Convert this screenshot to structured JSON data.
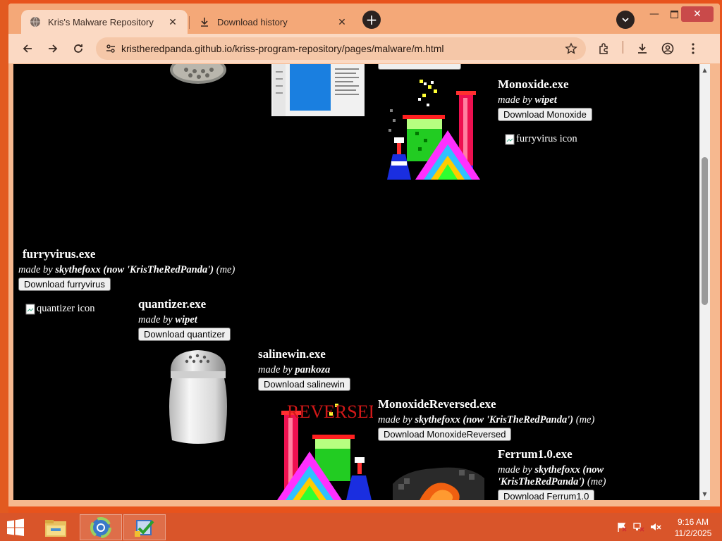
{
  "browser": {
    "tabs": [
      {
        "title": "Kris's Malware Repository",
        "active": true
      },
      {
        "title": "Download history",
        "active": false
      }
    ],
    "url": "kristheredpanda.github.io/kriss-program-repository/pages/malware/m.html"
  },
  "page": {
    "entries": {
      "monoxide": {
        "name": "Monoxide.exe",
        "made_by": "made by",
        "author": "wipet",
        "author_note": "",
        "button": "Download Monoxide"
      },
      "furryvirus": {
        "name": "furryvirus.exe",
        "made_by": "made by",
        "author": "skythefoxx (now 'KrisTheRedPanda')",
        "author_note": "(me)",
        "button": "Download furryvirus"
      },
      "quantizer": {
        "name": "quantizer.exe",
        "made_by": "made by",
        "author": "wipet",
        "author_note": "",
        "button": "Download quantizer"
      },
      "salinewin": {
        "name": "salinewin.exe",
        "made_by": "made by",
        "author": "pankoza",
        "author_note": "",
        "button": "Download salinewin"
      },
      "monoxidereversed": {
        "name": "MonoxideReversed.exe",
        "made_by": "made by",
        "author": "skythefoxx (now 'KrisTheRedPanda')",
        "author_note": "(me)",
        "button": "Download MonoxideReversed"
      },
      "ferrum": {
        "name": "Ferrum1.0.exe",
        "made_by": "made by",
        "author_line1": "skythefoxx (now",
        "author_line2": "'KrisTheRedPanda')",
        "author_note": "(me)",
        "button": "Download Ferrum1.0"
      }
    },
    "broken_images": {
      "furryvirus_icon": "furryvirus icon",
      "quantizer_icon": "quantizer icon"
    },
    "reversed_overlay": "REVERSED"
  },
  "taskbar": {
    "time": "9:16 AM",
    "date": "11/2/2025"
  },
  "colors": {
    "desktop": "#e8531c",
    "tab_strip": "#f4a878",
    "toolbar": "#fbd9c3",
    "page_bg": "#000000"
  }
}
